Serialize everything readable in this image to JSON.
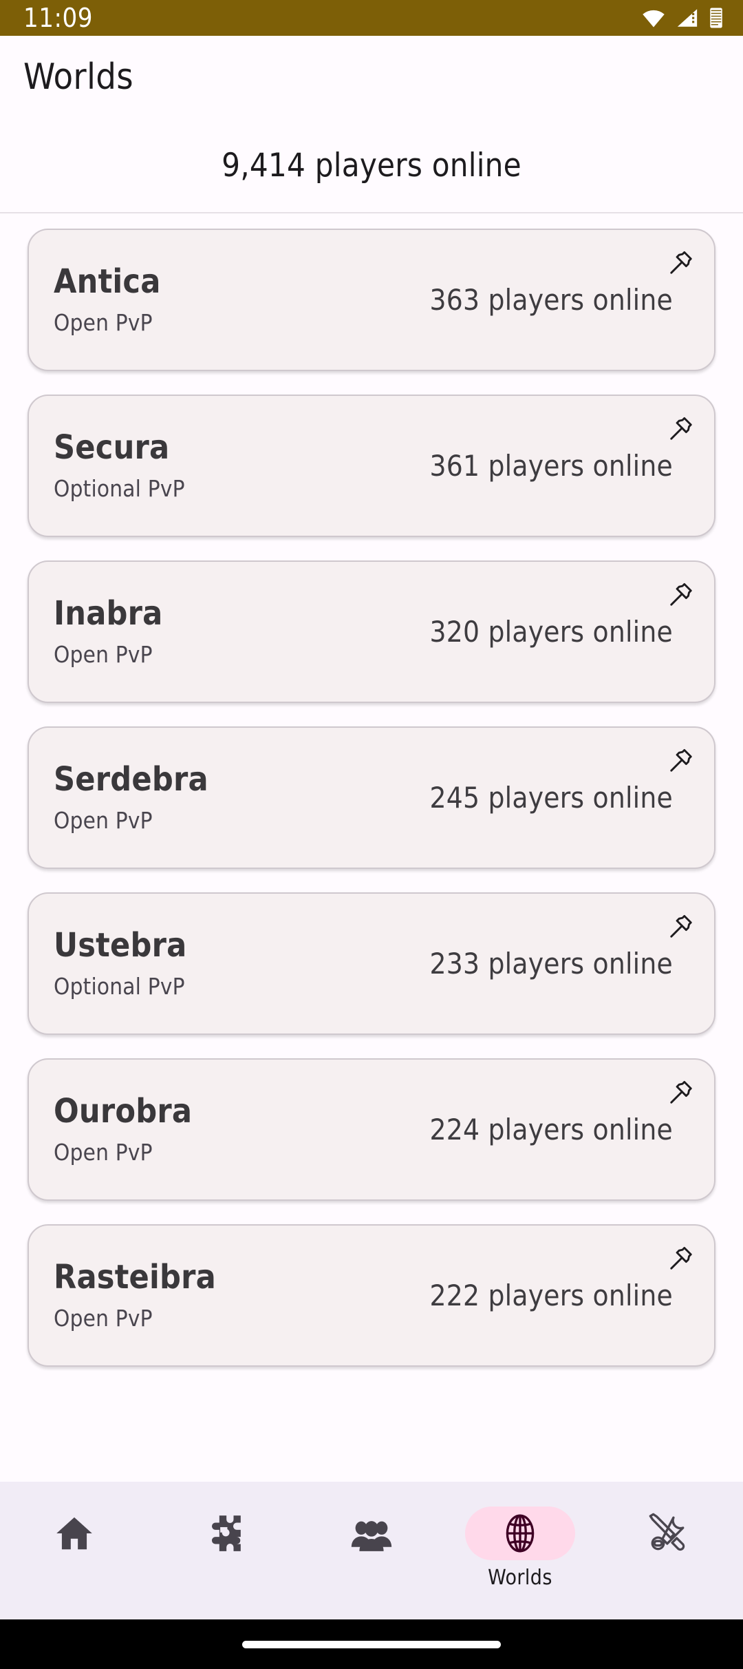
{
  "status_bar": {
    "time": "11:09",
    "background_color": "#7D5F07",
    "icons": [
      "wifi-icon",
      "cellular-signal-icon",
      "battery-icon"
    ]
  },
  "app_bar": {
    "title": "Worlds"
  },
  "summary": {
    "text": "9,414 players online"
  },
  "worlds": [
    {
      "name": "Antica",
      "pvp": "Open PvP",
      "players": "363 players online",
      "pin_icon": "pin-icon"
    },
    {
      "name": "Secura",
      "pvp": "Optional PvP",
      "players": "361 players online",
      "pin_icon": "pin-icon"
    },
    {
      "name": "Inabra",
      "pvp": "Open PvP",
      "players": "320 players online",
      "pin_icon": "pin-icon"
    },
    {
      "name": "Serdebra",
      "pvp": "Open PvP",
      "players": "245 players online",
      "pin_icon": "pin-icon"
    },
    {
      "name": "Ustebra",
      "pvp": "Optional PvP",
      "players": "233 players online",
      "pin_icon": "pin-icon"
    },
    {
      "name": "Ourobra",
      "pvp": "Open PvP",
      "players": "224 players online",
      "pin_icon": "pin-icon"
    },
    {
      "name": "Rasteibra",
      "pvp": "Open PvP",
      "players": "222 players online",
      "pin_icon": "pin-icon"
    }
  ],
  "bottom_nav": {
    "active_pill_color": "#FFD9EA",
    "background_color": "#F1ECF6",
    "items": [
      {
        "icon": "home-icon",
        "label": ""
      },
      {
        "icon": "puzzle-icon",
        "label": ""
      },
      {
        "icon": "people-icon",
        "label": ""
      },
      {
        "icon": "globe-icon",
        "label": "Worlds"
      },
      {
        "icon": "tools-icon",
        "label": ""
      }
    ]
  }
}
